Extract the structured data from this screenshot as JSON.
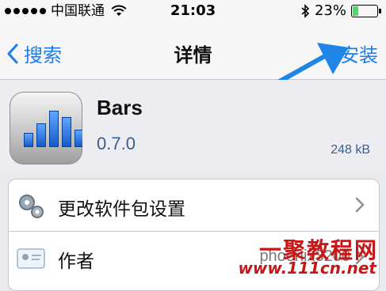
{
  "status_bar": {
    "carrier": "中国联通",
    "time": "21:03",
    "battery_percent": "23%",
    "battery_level": 0.23,
    "icons": [
      "signal-dots-icon",
      "wifi-icon",
      "bluetooth-icon",
      "battery-icon"
    ]
  },
  "nav": {
    "back_label": "搜索",
    "title": "详情",
    "install_label": "安装",
    "accent_color": "#1a7ef0"
  },
  "app": {
    "name": "Bars",
    "version": "0.7.0",
    "size": "248 kB"
  },
  "rows": [
    {
      "label": "更改软件包设置",
      "icon": "gears-icon",
      "chevron": true
    },
    {
      "label": "作者",
      "value": "phoenix3200",
      "icon": "contact-card-icon",
      "chevron": true
    }
  ],
  "watermark": {
    "line1": "一聚教程网",
    "line2": "www.111cn.net"
  }
}
